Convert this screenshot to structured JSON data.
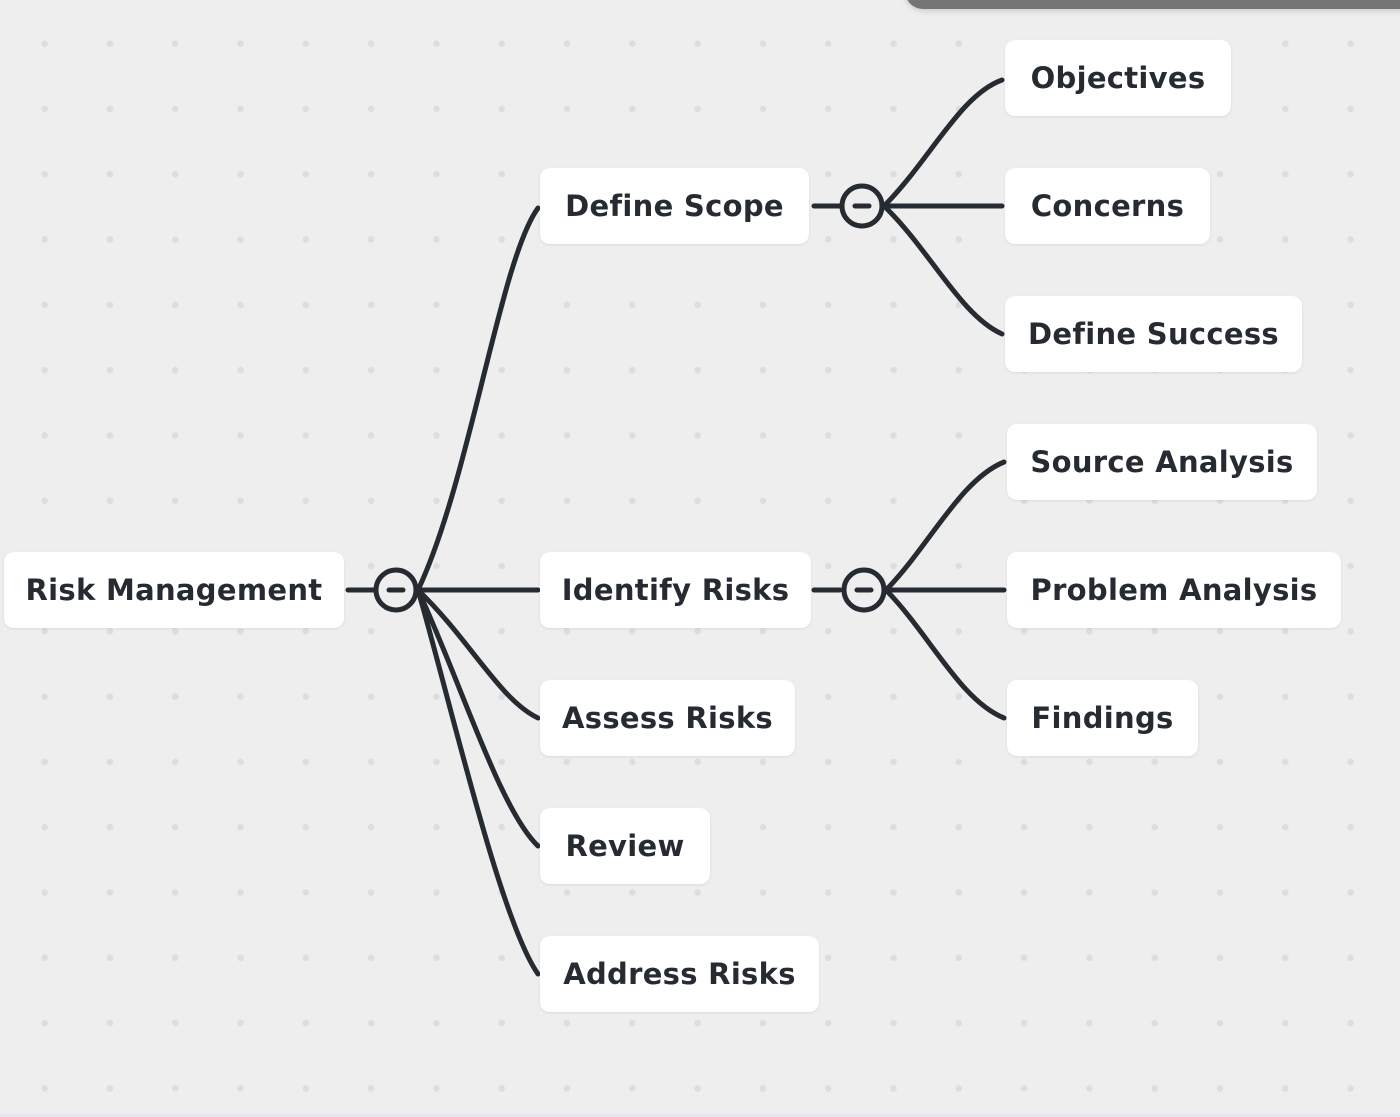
{
  "mindmap": {
    "root": {
      "id": "risk-management",
      "label": "Risk Management"
    },
    "nodes": [
      {
        "id": "define-scope",
        "label": "Define Scope",
        "parent": "risk-management"
      },
      {
        "id": "identify-risks",
        "label": "Identify Risks",
        "parent": "risk-management"
      },
      {
        "id": "assess-risks",
        "label": "Assess Risks",
        "parent": "risk-management"
      },
      {
        "id": "review",
        "label": "Review",
        "parent": "risk-management"
      },
      {
        "id": "address-risks",
        "label": "Address Risks",
        "parent": "risk-management"
      },
      {
        "id": "objectives",
        "label": "Objectives",
        "parent": "define-scope"
      },
      {
        "id": "concerns",
        "label": "Concerns",
        "parent": "define-scope"
      },
      {
        "id": "define-success",
        "label": "Define Success",
        "parent": "define-scope"
      },
      {
        "id": "source-analysis",
        "label": "Source Analysis",
        "parent": "identify-risks"
      },
      {
        "id": "problem-analysis",
        "label": "Problem Analysis",
        "parent": "identify-risks"
      },
      {
        "id": "findings",
        "label": "Findings",
        "parent": "identify-risks"
      }
    ],
    "collapse_toggles": [
      {
        "node": "risk-management",
        "state": "expanded",
        "icon": "collapse-minus-icon"
      },
      {
        "node": "define-scope",
        "state": "expanded",
        "icon": "collapse-minus-icon"
      },
      {
        "node": "identify-risks",
        "state": "expanded",
        "icon": "collapse-minus-icon"
      }
    ],
    "colors": {
      "line": "#262a31",
      "node_bg": "#ffffff",
      "canvas_bg": "#eeeeee",
      "text": "#262a31"
    }
  }
}
